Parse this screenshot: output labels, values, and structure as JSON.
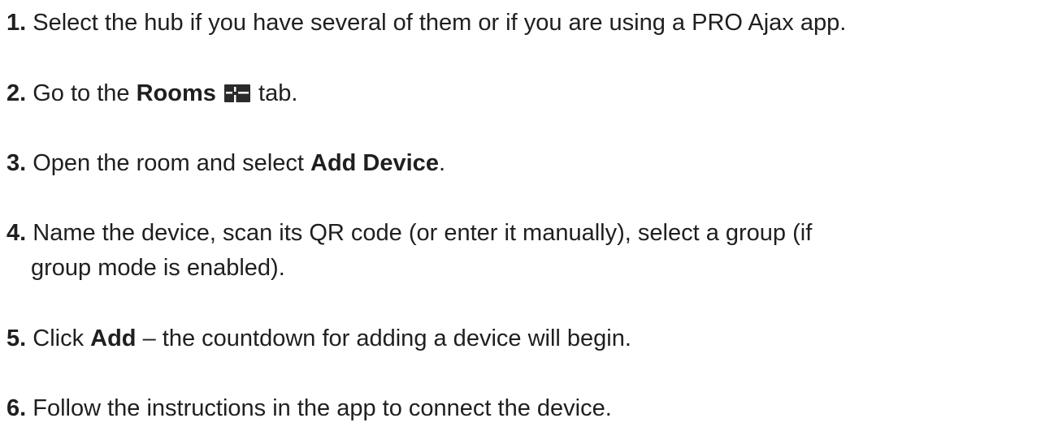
{
  "steps": [
    {
      "number": "1.",
      "text": " Select the hub if you have several of them or if you are using a PRO Ajax app."
    },
    {
      "number": "2.",
      "text_before": " Go to the ",
      "bold": "Rooms",
      "icon": "rooms-icon",
      "text_after": " tab."
    },
    {
      "number": "3.",
      "text_before": " Open the room and select ",
      "bold": "Add Device",
      "text_after": "."
    },
    {
      "number": "4.",
      "line1": " Name the device, scan its QR code (or enter it manually), select a group (if",
      "line2": "group mode is enabled)."
    },
    {
      "number": "5.",
      "text_before": " Click ",
      "bold": "Add",
      "text_after": " – the countdown for adding a device will begin."
    },
    {
      "number": "6.",
      "text": " Follow the instructions in the app to connect the device."
    }
  ]
}
